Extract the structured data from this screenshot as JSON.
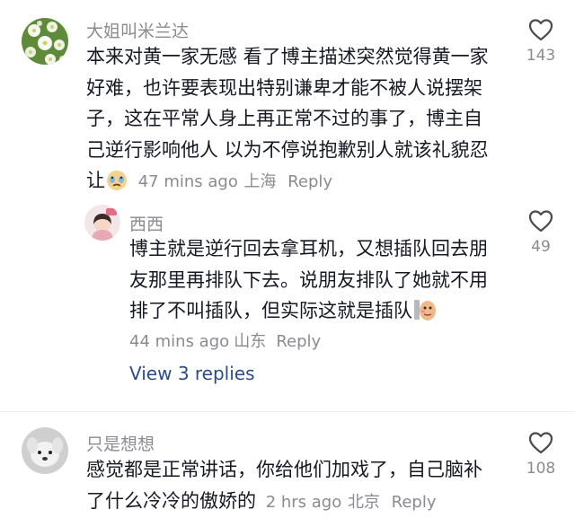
{
  "comments": [
    {
      "username": "大姐叫米兰达",
      "lines": [
        "本来对黄一家无感 看了博主描述突然觉得黄一家",
        "好难，也许要表现出特别谦卑才能不被人说摆架",
        "子，这在平常人身上再正常不过的事了，博主自",
        "己逆行影响他人 以为不停说抱歉别人就该礼貌忍"
      ],
      "last_line": "让",
      "time": "47 mins ago",
      "location": "上海",
      "reply_label": "Reply",
      "likes": "143",
      "emoji": "crying-emoji"
    },
    {
      "username": "西西",
      "lines": [
        "博主就是逆行回去拿耳机，又想插队回去朋",
        "友那里再排队下去。说朋友排队了她就不用"
      ],
      "last_line": "排了不叫插队，但实际这就是插队",
      "time": "44 mins ago",
      "location": "山东",
      "reply_label": "Reply",
      "likes": "49",
      "emoji": "peeking-emoji"
    },
    {
      "username": "只是想想",
      "lines": [
        "感觉都是正常讲话，你给他们加戏了，自己脑补"
      ],
      "last_line": "了什么冷冷的傲娇的",
      "time": "2 hrs ago",
      "location": "北京",
      "reply_label": "Reply",
      "likes": "108"
    }
  ],
  "view_replies": "View 3 replies"
}
